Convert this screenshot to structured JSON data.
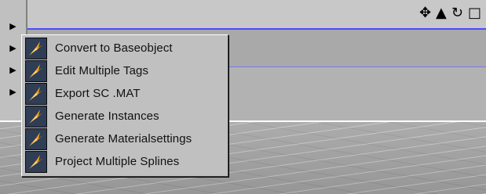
{
  "menu": {
    "items": [
      {
        "label": "Convert to Baseobject",
        "icon": "plugin-sparkle-icon"
      },
      {
        "label": "Edit Multiple Tags",
        "icon": "plugin-sparkle-icon"
      },
      {
        "label": "Export SC .MAT",
        "icon": "plugin-sparkle-icon"
      },
      {
        "label": "Generate Instances",
        "icon": "plugin-sparkle-icon"
      },
      {
        "label": "Generate Materialsettings",
        "icon": "plugin-sparkle-icon"
      },
      {
        "label": "Project Multiple Splines",
        "icon": "plugin-sparkle-icon"
      }
    ]
  },
  "viewport": {
    "header_icons": [
      "move-icon",
      "scale-icon",
      "rotate-icon",
      "maximize-icon"
    ],
    "accent_line_color": "#4a4aff"
  },
  "left_strip": {
    "arrows": [
      "submenu-arrow-icon",
      "submenu-arrow-icon",
      "submenu-arrow-icon",
      "submenu-arrow-icon"
    ]
  }
}
